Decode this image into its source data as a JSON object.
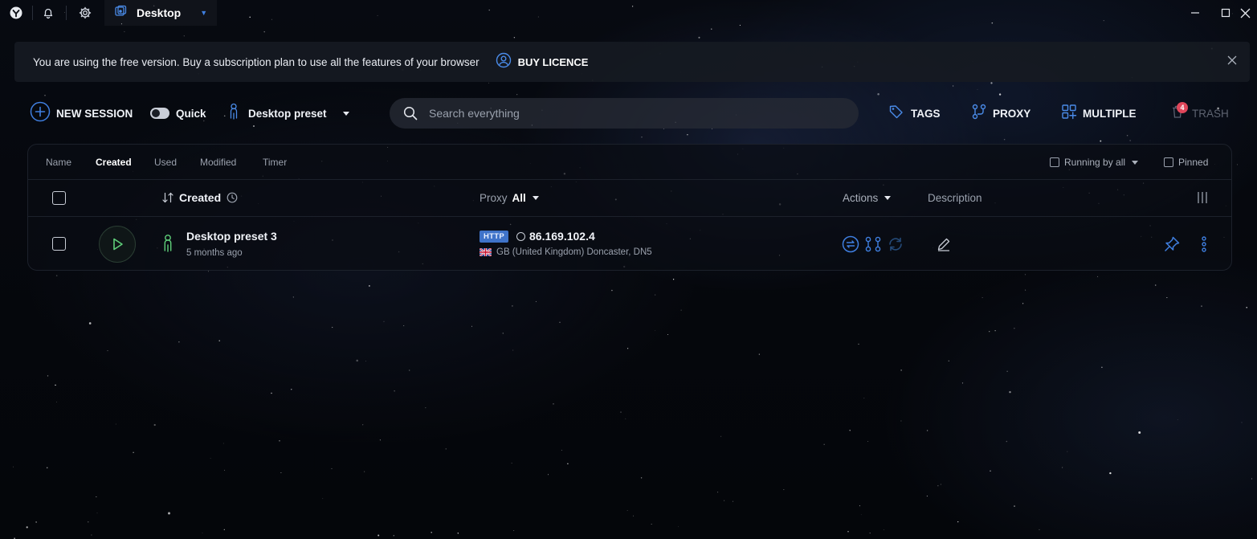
{
  "app": {
    "tab_title": "Desktop",
    "icons": [
      "logo-icon",
      "bell-icon",
      "gear-icon",
      "desktop-tab-icon",
      "minimize-icon",
      "maximize-icon",
      "close-window-icon"
    ]
  },
  "banner": {
    "text": "You are using the free version. Buy a subscription plan to use all the features of your browser",
    "cta": "BUY LICENCE"
  },
  "toolbar": {
    "new_session": "NEW SESSION",
    "quick": "Quick",
    "quick_enabled": false,
    "preset": "Desktop preset",
    "search_placeholder": "Search everything",
    "tags": "TAGS",
    "proxy": "PROXY",
    "multiple": "MULTIPLE",
    "trash": "TRASH",
    "trash_count": "4"
  },
  "sort_tabs": [
    {
      "label": "Name",
      "active": false
    },
    {
      "label": "Created",
      "active": true
    },
    {
      "label": "Used",
      "active": false
    },
    {
      "label": "Modified",
      "active": false
    },
    {
      "label": "Timer",
      "active": false
    }
  ],
  "filters": {
    "running": "Running by all",
    "pinned": "Pinned"
  },
  "table": {
    "header": {
      "created": "Created",
      "proxy": "Proxy",
      "proxy_filter": "All",
      "actions": "Actions",
      "description": "Description"
    },
    "rows": [
      {
        "name": "Desktop preset 3",
        "created": "5 months ago",
        "proxy_type": "HTTP",
        "ip": "86.169.102.4",
        "location": "GB (United Kingdom) Doncaster, DN5"
      }
    ]
  },
  "colors": {
    "accent": "#3f7fe0",
    "play_green": "#5fd07a",
    "badge_red": "#e0465a"
  }
}
